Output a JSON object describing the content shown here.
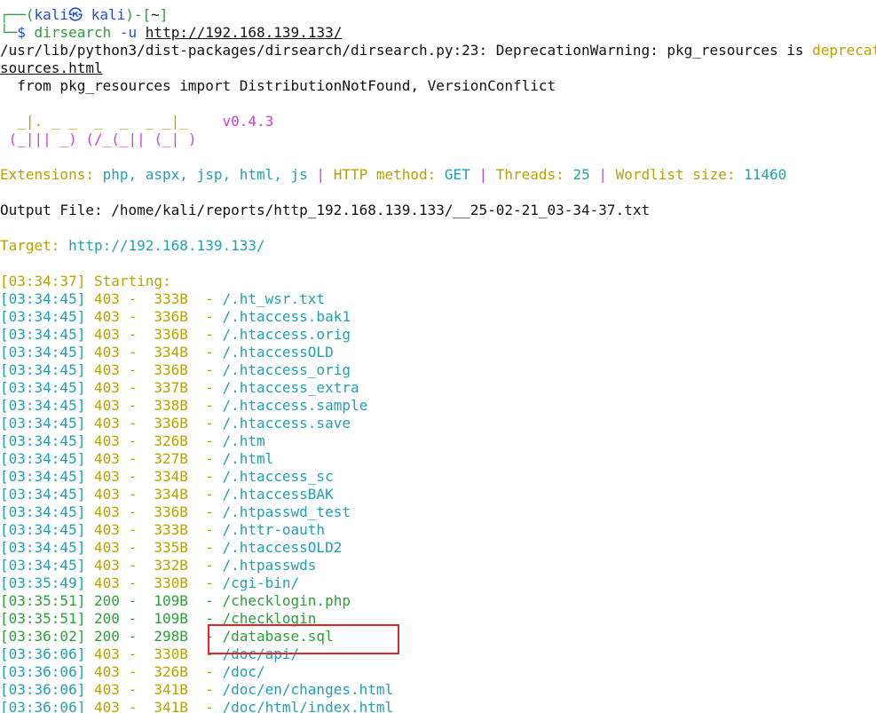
{
  "colors": {
    "red_box": "#e0262b"
  },
  "prompt": {
    "corner": "┌──(",
    "user": "kali㉿ kali",
    "mid": ")-[",
    "dir": "~",
    "end": "]",
    "corner2": "└─",
    "symbol": "$",
    "command": "dirsearch",
    "args": "-u",
    "url": "http://192.168.139.133/"
  },
  "warning": {
    "line1": "/usr/lib/python3/dist-packages/dirsearch/dirsearch.py:23: DeprecationWarning: pkg_resources is ",
    "line1_highlight": "deprecated",
    "line2": "sources.html",
    "line3": "  from pkg_resources import DistributionNotFound, VersionConflict"
  },
  "banner": {
    "art1": "  _|. _ _  _  _  _ _|_    ",
    "version": "v0.4.3",
    "art2": " (_||| _) (/_(_|| (_| )"
  },
  "config": {
    "ext_label": "Extensions: ",
    "ext_value": "php, aspx, jsp, html, js",
    "sep": " | ",
    "method_label": "HTTP method: ",
    "method_value": "GET",
    "threads_label": "Threads: ",
    "threads_value": "25",
    "wordlist_label": "Wordlist size: ",
    "wordlist_value": "11460"
  },
  "output_file": "Output File: /home/kali/reports/http_192.168.139.133/__25-02-21_03-34-37.txt",
  "target": {
    "label": "Target: ",
    "url": "http://192.168.139.133/"
  },
  "starting": {
    "time": "[03:34:37]",
    "text": " Starting:"
  },
  "results": [
    {
      "time": "[03:34:45]",
      "code": "403",
      "size": "333B",
      "path": "/.ht_wsr.txt"
    },
    {
      "time": "[03:34:45]",
      "code": "403",
      "size": "336B",
      "path": "/.htaccess.bak1"
    },
    {
      "time": "[03:34:45]",
      "code": "403",
      "size": "336B",
      "path": "/.htaccess.orig"
    },
    {
      "time": "[03:34:45]",
      "code": "403",
      "size": "334B",
      "path": "/.htaccessOLD"
    },
    {
      "time": "[03:34:45]",
      "code": "403",
      "size": "336B",
      "path": "/.htaccess_orig"
    },
    {
      "time": "[03:34:45]",
      "code": "403",
      "size": "337B",
      "path": "/.htaccess_extra"
    },
    {
      "time": "[03:34:45]",
      "code": "403",
      "size": "338B",
      "path": "/.htaccess.sample"
    },
    {
      "time": "[03:34:45]",
      "code": "403",
      "size": "336B",
      "path": "/.htaccess.save"
    },
    {
      "time": "[03:34:45]",
      "code": "403",
      "size": "326B",
      "path": "/.htm"
    },
    {
      "time": "[03:34:45]",
      "code": "403",
      "size": "327B",
      "path": "/.html"
    },
    {
      "time": "[03:34:45]",
      "code": "403",
      "size": "334B",
      "path": "/.htaccess_sc"
    },
    {
      "time": "[03:34:45]",
      "code": "403",
      "size": "334B",
      "path": "/.htaccessBAK"
    },
    {
      "time": "[03:34:45]",
      "code": "403",
      "size": "336B",
      "path": "/.htpasswd_test"
    },
    {
      "time": "[03:34:45]",
      "code": "403",
      "size": "333B",
      "path": "/.httr-oauth"
    },
    {
      "time": "[03:34:45]",
      "code": "403",
      "size": "335B",
      "path": "/.htaccessOLD2"
    },
    {
      "time": "[03:34:45]",
      "code": "403",
      "size": "332B",
      "path": "/.htpasswds"
    },
    {
      "time": "[03:35:49]",
      "code": "403",
      "size": "330B",
      "path": "/cgi-bin/"
    },
    {
      "time": "[03:35:51]",
      "code": "200",
      "size": "109B",
      "path": "/checklogin.php"
    },
    {
      "time": "[03:35:51]",
      "code": "200",
      "size": "109B",
      "path": "/checklogin"
    },
    {
      "time": "[03:36:02]",
      "code": "200",
      "size": "298B",
      "path": "/database.sql"
    },
    {
      "time": "[03:36:06]",
      "code": "403",
      "size": "330B",
      "path": "/doc/api/"
    },
    {
      "time": "[03:36:06]",
      "code": "403",
      "size": "326B",
      "path": "/doc/"
    },
    {
      "time": "[03:36:06]",
      "code": "403",
      "size": "341B",
      "path": "/doc/en/changes.html"
    },
    {
      "time": "[03:36:06]",
      "code": "403",
      "size": "341B",
      "path": "/doc/html/index.html"
    }
  ]
}
